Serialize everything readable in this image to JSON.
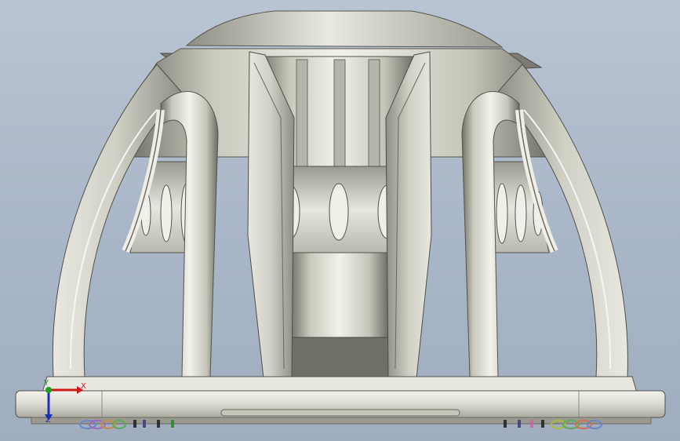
{
  "viewport": {
    "background_colors": [
      "#b9c4d3",
      "#9fadbf"
    ],
    "model": "gearbox-housing-assembly",
    "view_orientation": "front"
  },
  "triad": {
    "x_label": "X",
    "y_label": "Y",
    "z_label": "Z",
    "x_color": "#d01818",
    "y_color": "#1fa01f",
    "z_color": "#1b2fb8"
  },
  "wire_colors": [
    "#6a86c8",
    "#9b6ac9",
    "#c98a4a",
    "#5aa85a",
    "#c96aa0",
    "#4a8a8a",
    "#aabb44",
    "#d07050"
  ]
}
